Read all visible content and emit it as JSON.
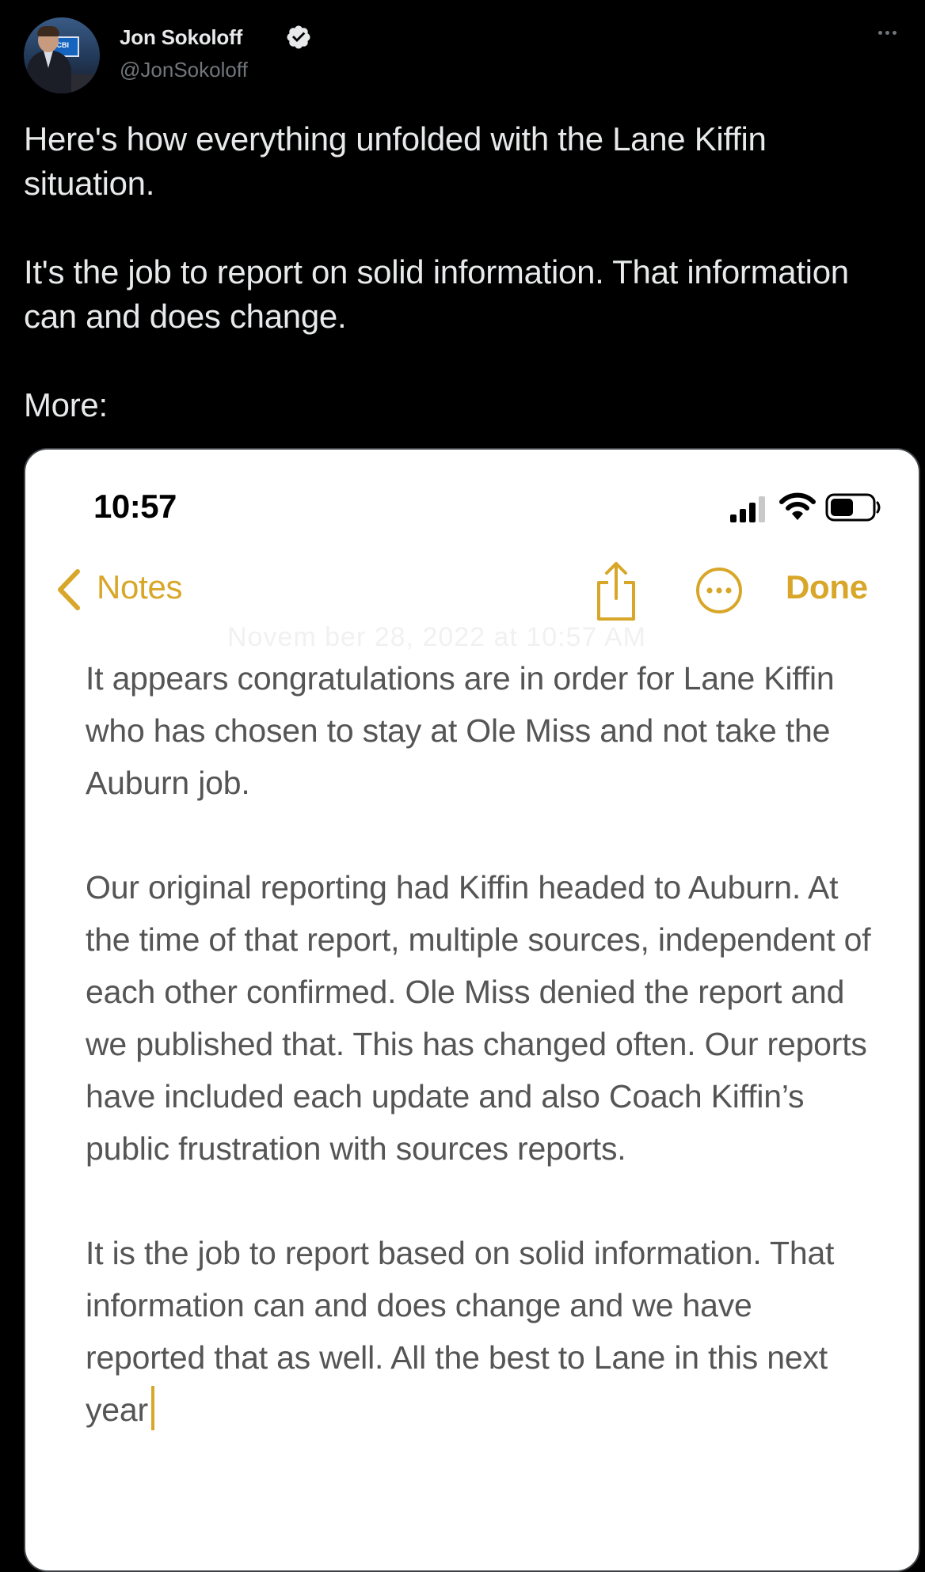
{
  "tweet": {
    "author_name": "Jon Sokoloff",
    "author_handle": "@JonSokoloff",
    "avatar_channel_text": "WCBI",
    "paragraphs": [
      "Here's how everything unfolded with the Lane Kiffin situation.",
      "It's the job to report on solid information. That information can and does change.",
      "More:"
    ]
  },
  "phone_screenshot": {
    "status_bar": {
      "time": "10:57"
    },
    "nav": {
      "back_label": "Notes",
      "done_label": "Done"
    },
    "faded_date": "Novem ber 28, 2022 at 10:57 AM",
    "note_paragraphs": [
      "It appears congratulations are in order for Lane Kiffin who has chosen to stay at Ole Miss and not take the Auburn job.",
      "Our original reporting had Kiffin headed to Auburn. At the time of that report, multiple sources, independent of each other confirmed. Ole Miss denied the report and we published that. This has changed often. Our reports have included each update and also Coach Kiffin’s public frustration with sources reports.",
      "It is the job to report based on solid information. That information can and does change and we have reported that as well. All the best to Lane in this next year"
    ]
  },
  "colors": {
    "background": "#000000",
    "primary_text": "#e7e9ea",
    "secondary_text": "#71767b",
    "notes_accent": "#d8a72a",
    "note_text": "#555555"
  },
  "icons": [
    "verified-icon",
    "more-icon",
    "signal-icon",
    "wifi-icon",
    "battery-icon",
    "back-chevron-icon",
    "share-icon",
    "ellipsis-circle-icon"
  ]
}
